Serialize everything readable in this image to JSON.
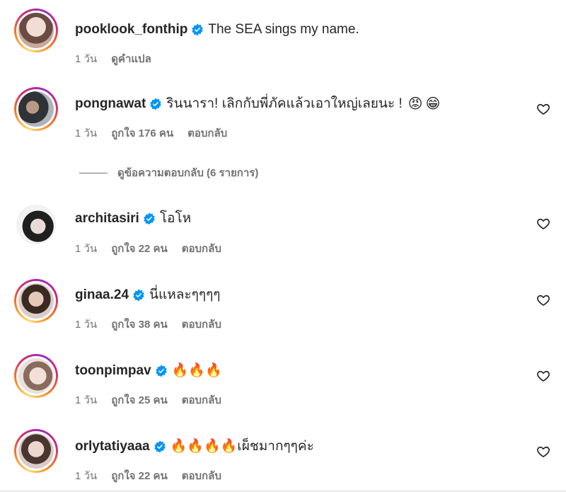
{
  "colors": {
    "verified": "#0095f6",
    "meta": "#737373",
    "text": "#262626",
    "fire": "#f4900c"
  },
  "comments": [
    {
      "username": "pooklook_fonthip",
      "text": "The SEA sings my name.",
      "time": "1 วัน",
      "action": "ดูคำแปล",
      "avatar_ring": true,
      "avatar_colors": [
        "#e8d2cc",
        "#7a5a50"
      ]
    },
    {
      "username": "pongnawat",
      "text": "รินนารา! เลิกกับพี่ภัคแล้วเอาใหญ่เลยนะ !",
      "emojis": [
        "😡",
        "😁"
      ],
      "time": "1 วัน",
      "likes": "ถูกใจ 176 คน",
      "reply": "ตอบกลับ",
      "avatar_ring": true,
      "avatar_colors": [
        "#c8cdd2",
        "#3a3f45"
      ]
    },
    {
      "username": "architasiri",
      "text": "โอโห",
      "time": "1 วัน",
      "likes": "ถูกใจ 22 คน",
      "reply": "ตอบกลับ",
      "avatar_ring": false,
      "avatar_colors": [
        "#e6e6e6",
        "#2a2a2a"
      ]
    },
    {
      "username": "ginaa.24",
      "text": "นี่แหละๆๆๆๆ",
      "time": "1 วัน",
      "likes": "ถูกใจ 38 คน",
      "reply": "ตอบกลับ",
      "avatar_ring": true,
      "avatar_colors": [
        "#d9c1b4",
        "#3b2a22"
      ]
    },
    {
      "username": "toonpimpav",
      "text": "🔥🔥🔥",
      "time": "1 วัน",
      "likes": "ถูกใจ 25 คน",
      "reply": "ตอบกลับ",
      "avatar_ring": true,
      "avatar_colors": [
        "#ead8cf",
        "#8a6a5c"
      ]
    },
    {
      "username": "orlytatiyaaa",
      "text": "🔥🔥🔥🔥เผ็ชมากๆๆค่ะ",
      "time": "1 วัน",
      "likes": "ถูกใจ 22 คน",
      "reply": "ตอบกลับ",
      "avatar_ring": true,
      "avatar_colors": [
        "#e3d0c8",
        "#4a3530"
      ]
    }
  ],
  "view_replies": "ดูข้อความตอบกลับ (6 รายการ)",
  "icons": {
    "verified": "verified-badge-icon",
    "like": "heart-icon"
  }
}
